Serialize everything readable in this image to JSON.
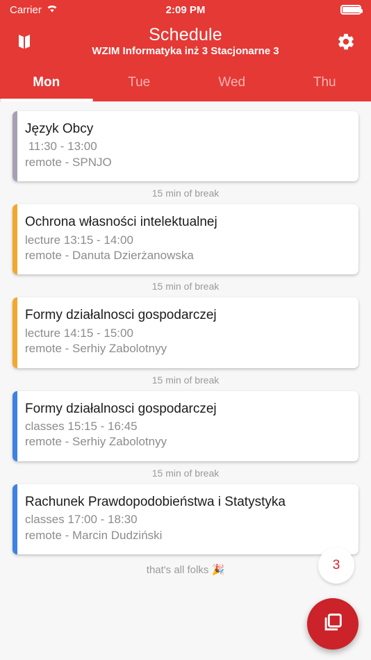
{
  "status_bar": {
    "carrier": "Carrier",
    "time": "2:09 PM",
    "wifi_icon": "wifi-icon",
    "battery_icon": "battery-icon"
  },
  "app_bar": {
    "title": "Schedule",
    "subtitle": "WZIM Informatyka inż 3 Stacjonarne 3",
    "left_icon": "map-icon",
    "right_icon": "gear-icon"
  },
  "tabs": {
    "items": [
      {
        "label": "Mon",
        "active": true
      },
      {
        "label": "Tue",
        "active": false
      },
      {
        "label": "Wed",
        "active": false
      },
      {
        "label": "Thu",
        "active": false
      }
    ]
  },
  "colors": {
    "brand_red": "#e53935",
    "fab_red": "#cc2229",
    "accent_purple": "#a99fb5",
    "accent_orange": "#f2a72e",
    "accent_blue": "#3d82e0",
    "background": "#f7f7f7",
    "card": "#ffffff"
  },
  "schedule": {
    "entries": [
      {
        "title": "Język Obcy",
        "time_line": " 11:30 - 13:00",
        "location_line": "remote - SPNJO",
        "accent": "#a99fb5",
        "kind": ""
      },
      {
        "title": "Ochrona własności intelektualnej",
        "time_line": "lecture 13:15 - 14:00",
        "location_line": "remote - Danuta Dzierżanowska",
        "accent": "#f2a72e",
        "kind": "lecture"
      },
      {
        "title": "Formy działalnosci gospodarczej",
        "time_line": "lecture 14:15 - 15:00",
        "location_line": "remote - Serhiy Zabolotnyy",
        "accent": "#f2a72e",
        "kind": "lecture"
      },
      {
        "title": "Formy działalnosci gospodarczej",
        "time_line": "classes 15:15 - 16:45",
        "location_line": "remote - Serhiy Zabolotnyy",
        "accent": "#3d82e0",
        "kind": "classes"
      },
      {
        "title": "Rachunek Prawdopodobieństwa i Statystyka",
        "time_line": "classes 17:00 - 18:30",
        "location_line": "remote - Marcin Dudziński",
        "accent": "#3d82e0",
        "kind": "classes"
      }
    ],
    "break_label": "15 min of break",
    "end_note": "that's all folks 🎉"
  },
  "floating": {
    "badge_count": "3",
    "fab_icon": "layers-copy-icon"
  }
}
